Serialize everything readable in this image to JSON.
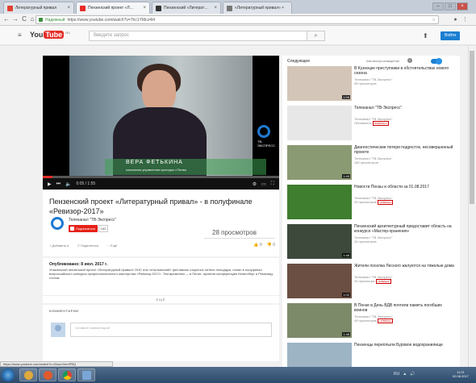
{
  "browser": {
    "tabs": [
      {
        "label": "Литературный привал",
        "favicon_color": "#e0412f",
        "active": false
      },
      {
        "label": "Пензенский проект «Л…",
        "favicon_color": "#e52d27",
        "active": true
      },
      {
        "label": "Пензенский «Литерат…",
        "favicon_color": "#333333",
        "active": false
      },
      {
        "label": "«Литературный привал» ×",
        "favicon_color": "#777777",
        "active": false
      }
    ],
    "window_buttons": [
      "–",
      "□",
      "×"
    ],
    "back": "←",
    "forward": "→",
    "reload": "C",
    "home": "⌂",
    "secure_label": "Надежный",
    "url": "https://www.youtube.com/watch?v=7hc1YMcz4I4",
    "star": "☆"
  },
  "youtube": {
    "logo_you": "You",
    "logo_tube": "Tube",
    "logo_region": "RU",
    "search_placeholder": "Введите запрос",
    "search_icon": "⌕",
    "upload_icon": "⬆",
    "signin_label": "Войти"
  },
  "player": {
    "channel_bug_label": "ТВ-ЭКСПРЕСС",
    "lower_third_name": "ВЕРА ФЕТЬКИНА",
    "lower_third_role": "начальник управления культуры г.Пензы",
    "time": "0:05 / 1:55",
    "progress": 0.04,
    "play_icon": "▶",
    "next_icon": "⏭",
    "volume_icon": "🔈",
    "settings_icon": "⚙",
    "miniplayer_icon": "▭",
    "fullscreen_icon": "⛶"
  },
  "video": {
    "title": "Пензенский проект «Литературный привал» - в полуфинале «Ревизор-2017»",
    "channel": "Телеканал \"ТВ-Экспресс\"",
    "subscribe_label": "Подписаться",
    "subscriber_count": "183",
    "views": "28 просмотров",
    "actions": [
      "+ Добавить в",
      "↗ Поделиться",
      "··· Ещё"
    ],
    "likes": "0",
    "dislikes": "0",
    "like_icon": "👍",
    "dislike_icon": "👎",
    "published": "Опубликовано: 8 июл. 2017 г.",
    "description": "Уникальный пензенский проект «Литературный привал» ОНС или «итальянский» фестиваль открытых летних площадок, попал в полуфинал всероссийского конкурса профессионального мастерства «Ревизор-2017». Тем временем — в Пензе, провели конференцию Кенигсберг и Ремизицу гостям.",
    "more_label": "ЕЩЁ",
    "comments_header": "КОММЕНТАРИИ",
    "comment_placeholder": "Оставьте комментарий"
  },
  "sidebar": {
    "up_next": "Следующее",
    "autoplay_label": "Автовоспроизведение",
    "autoplay_info": "i",
    "items": [
      {
        "title": "В Кузнецке преступники в обстоятельствах нового сезона",
        "channel": "Телеканал \"ТВ-Экспресс\"",
        "views": "98 просмотров",
        "duration": "1:06",
        "thumb": "#d3c6b8",
        "badge": ""
      },
      {
        "title": "Телеканал \"ТВ-Экспресс\"",
        "channel": "Телеканал \"ТВ-Экспресс\"",
        "views": "Обновлено",
        "duration": "",
        "thumb": "#e7e7e7",
        "badge": "ПЛЕЙЛИСТ"
      },
      {
        "title": "Диагностические потери подросток, несовершенный проекте",
        "channel": "Телеканал \"ТВ-Экспресс\"",
        "views": "180 просмотров",
        "duration": "1:49",
        "thumb": "#8a9a72",
        "badge": ""
      },
      {
        "title": "Новости Пензы и области за 01.08.2017",
        "channel": "Телеканал \"ТВ-Экспресс\"",
        "views": "39 просмотров",
        "duration": "",
        "thumb": "#3f7d2f",
        "badge": "НОВИНКА"
      },
      {
        "title": "Пензенский архитектурный предоставит область на конкурсе «Мастер-хранения»",
        "channel": "Телеканал \"ТВ-Экспресс\"",
        "views": "26 просмотров",
        "duration": "1:46",
        "thumb": "#3d4a3b",
        "badge": ""
      },
      {
        "title": "Жители поселка Лесного жалуются на тяжелые дома",
        "channel": "Телеканал \"ТВ-Экспресс\"",
        "views": "34 просмотра",
        "duration": "1:02",
        "thumb": "#6b4f42",
        "badge": "НОВИНКА"
      },
      {
        "title": "В Пензе в День ВДВ почтили память погибших воинов",
        "channel": "Телеканал \"ТВ-Экспресс\"",
        "views": "49 просмотров",
        "duration": "1:48",
        "thumb": "#7d8a6a",
        "badge": "НОВИНКА"
      },
      {
        "title": "Пензенцы переплыли Буровое водохранилище",
        "channel": "",
        "views": "",
        "duration": "",
        "thumb": "#9db4c5",
        "badge": ""
      }
    ]
  },
  "status_url": "https://www.youtube.com/watch?v=lZsuuVmmPBQ",
  "taskbar": {
    "tray": [
      "RU",
      "▲",
      "🔊"
    ],
    "time": "11:21",
    "date": "02.08.2017"
  }
}
